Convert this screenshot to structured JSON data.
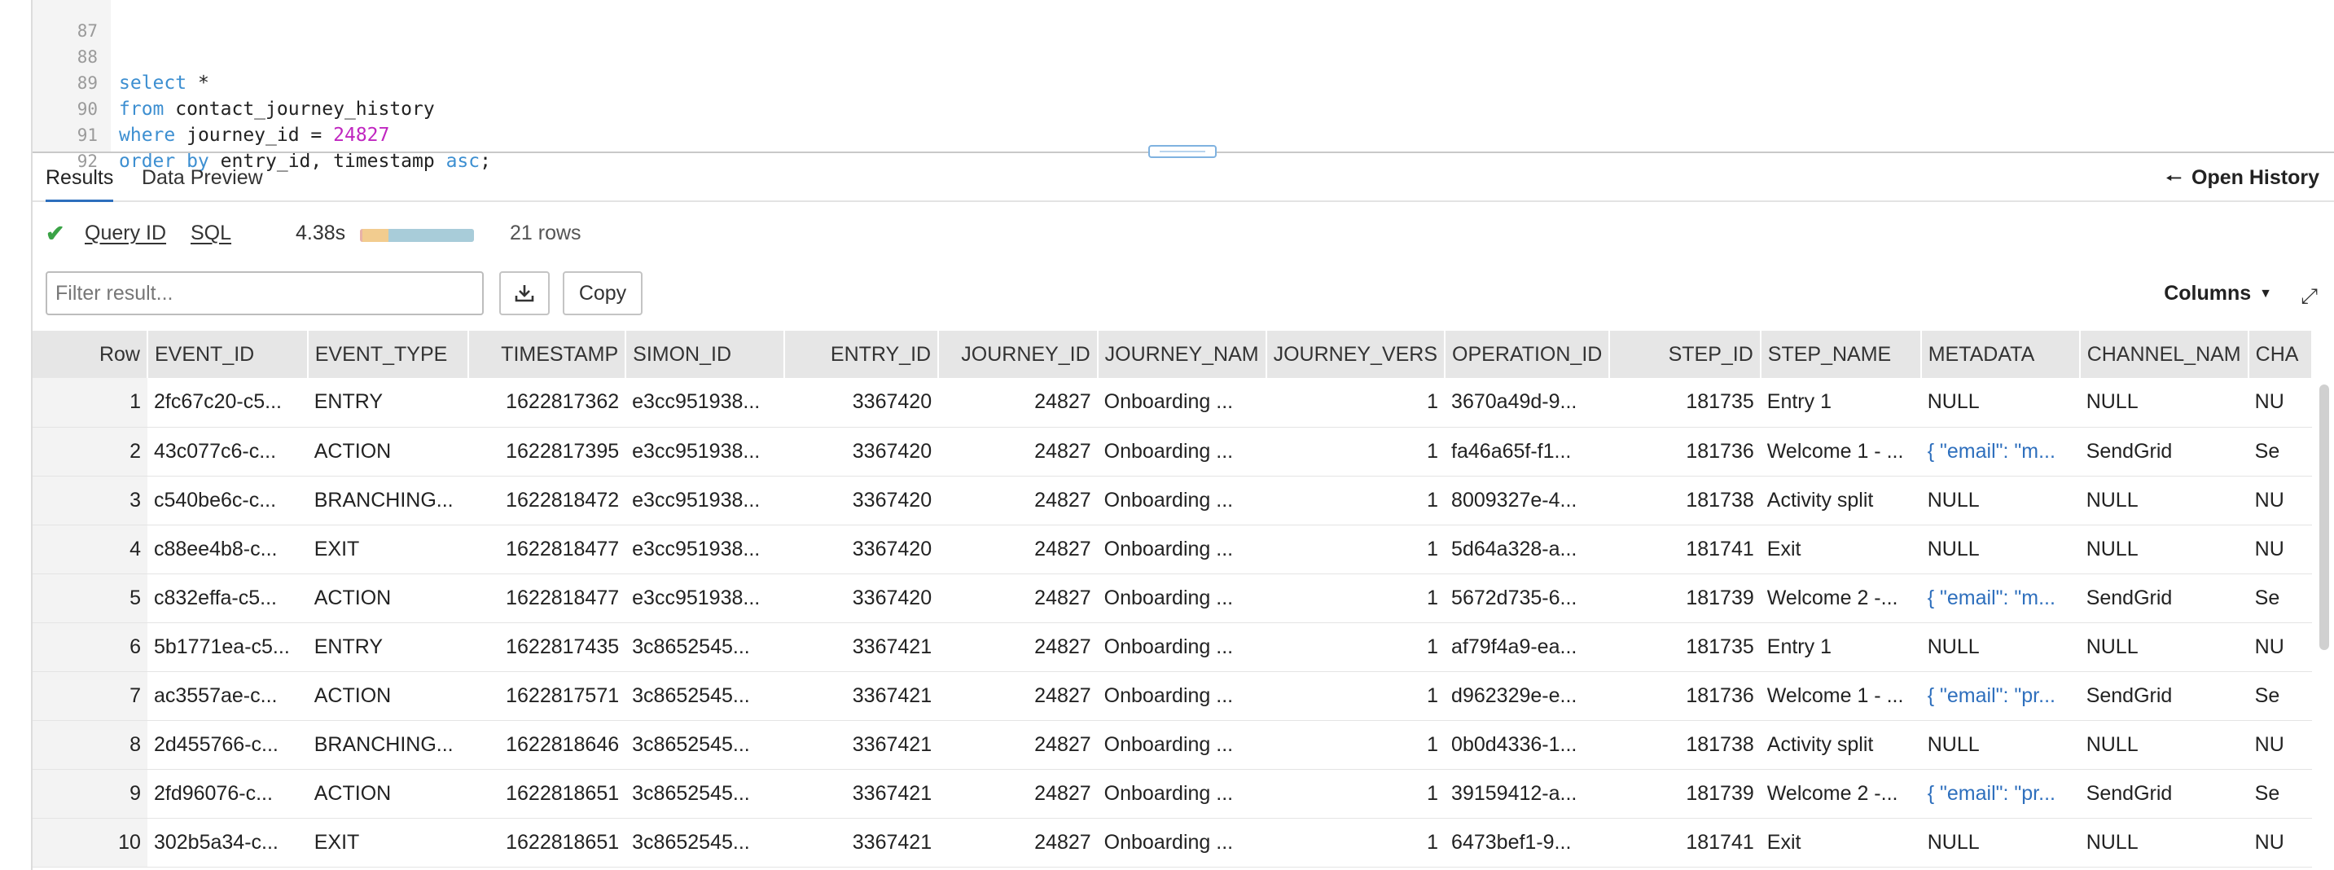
{
  "editor": {
    "lines": [
      {
        "num": "87",
        "code": ""
      },
      {
        "num": "88",
        "code": "select *"
      },
      {
        "num": "89",
        "code": "from contact_journey_history"
      },
      {
        "num": "90",
        "code": "where journey_id = 24827"
      },
      {
        "num": "91",
        "code": "order by entry_id, timestamp asc;"
      },
      {
        "num": "92",
        "code": ""
      }
    ]
  },
  "tabs": {
    "results": "Results",
    "data_preview": "Data Preview"
  },
  "open_history": "Open History",
  "query": {
    "query_id": "Query ID",
    "sql": "SQL",
    "duration": "4.38s",
    "rows": "21 rows",
    "timing_fractions": [
      0.02,
      0.23,
      0.75
    ]
  },
  "toolbar": {
    "filter_placeholder": "Filter result...",
    "copy": "Copy",
    "columns": "Columns"
  },
  "colors": {
    "accent": "#2d6fbd",
    "success": "#3aa346",
    "timing_compile": "#e8b2a8",
    "timing_queue": "#f2cc8f",
    "timing_exec": "#a8ccd9"
  },
  "table": {
    "headers": [
      "Row",
      "EVENT_ID",
      "EVENT_TYPE",
      "TIMESTAMP",
      "SIMON_ID",
      "ENTRY_ID",
      "JOURNEY_ID",
      "JOURNEY_NAM",
      "JOURNEY_VERS",
      "OPERATION_ID",
      "STEP_ID",
      "STEP_NAME",
      "METADATA",
      "CHANNEL_NAM",
      "CHA"
    ],
    "rows": [
      [
        "1",
        "2fc67c20-c5...",
        "ENTRY",
        "1622817362",
        "e3cc951938...",
        "3367420",
        "24827",
        "Onboarding ...",
        "1",
        "3670a49d-9...",
        "181735",
        "Entry 1",
        "NULL",
        "NULL",
        "NU"
      ],
      [
        "2",
        "43c077c6-c...",
        "ACTION",
        "1622817395",
        "e3cc951938...",
        "3367420",
        "24827",
        "Onboarding ...",
        "1",
        "fa46a65f-f1...",
        "181736",
        "Welcome 1 - ...",
        "{ \"email\": \"m...",
        "SendGrid",
        "Se"
      ],
      [
        "3",
        "c540be6c-c...",
        "BRANCHING...",
        "1622818472",
        "e3cc951938...",
        "3367420",
        "24827",
        "Onboarding ...",
        "1",
        "8009327e-4...",
        "181738",
        "Activity split",
        "NULL",
        "NULL",
        "NU"
      ],
      [
        "4",
        "c88ee4b8-c...",
        "EXIT",
        "1622818477",
        "e3cc951938...",
        "3367420",
        "24827",
        "Onboarding ...",
        "1",
        "5d64a328-a...",
        "181741",
        "Exit",
        "NULL",
        "NULL",
        "NU"
      ],
      [
        "5",
        "c832effa-c5...",
        "ACTION",
        "1622818477",
        "e3cc951938...",
        "3367420",
        "24827",
        "Onboarding ...",
        "1",
        "5672d735-6...",
        "181739",
        "Welcome 2 -...",
        "{ \"email\": \"m...",
        "SendGrid",
        "Se"
      ],
      [
        "6",
        "5b1771ea-c5...",
        "ENTRY",
        "1622817435",
        "3c8652545...",
        "3367421",
        "24827",
        "Onboarding ...",
        "1",
        "af79f4a9-ea...",
        "181735",
        "Entry 1",
        "NULL",
        "NULL",
        "NU"
      ],
      [
        "7",
        "ac3557ae-c...",
        "ACTION",
        "1622817571",
        "3c8652545...",
        "3367421",
        "24827",
        "Onboarding ...",
        "1",
        "d962329e-e...",
        "181736",
        "Welcome 1 - ...",
        "{ \"email\": \"pr...",
        "SendGrid",
        "Se"
      ],
      [
        "8",
        "2d455766-c...",
        "BRANCHING...",
        "1622818646",
        "3c8652545...",
        "3367421",
        "24827",
        "Onboarding ...",
        "1",
        "0b0d4336-1...",
        "181738",
        "Activity split",
        "NULL",
        "NULL",
        "NU"
      ],
      [
        "9",
        "2fd96076-c...",
        "ACTION",
        "1622818651",
        "3c8652545...",
        "3367421",
        "24827",
        "Onboarding ...",
        "1",
        "39159412-a...",
        "181739",
        "Welcome 2 -...",
        "{ \"email\": \"pr...",
        "SendGrid",
        "Se"
      ],
      [
        "10",
        "302b5a34-c...",
        "EXIT",
        "1622818651",
        "3c8652545...",
        "3367421",
        "24827",
        "Onboarding ...",
        "1",
        "6473bef1-9...",
        "181741",
        "Exit",
        "NULL",
        "NULL",
        "NU"
      ]
    ]
  }
}
